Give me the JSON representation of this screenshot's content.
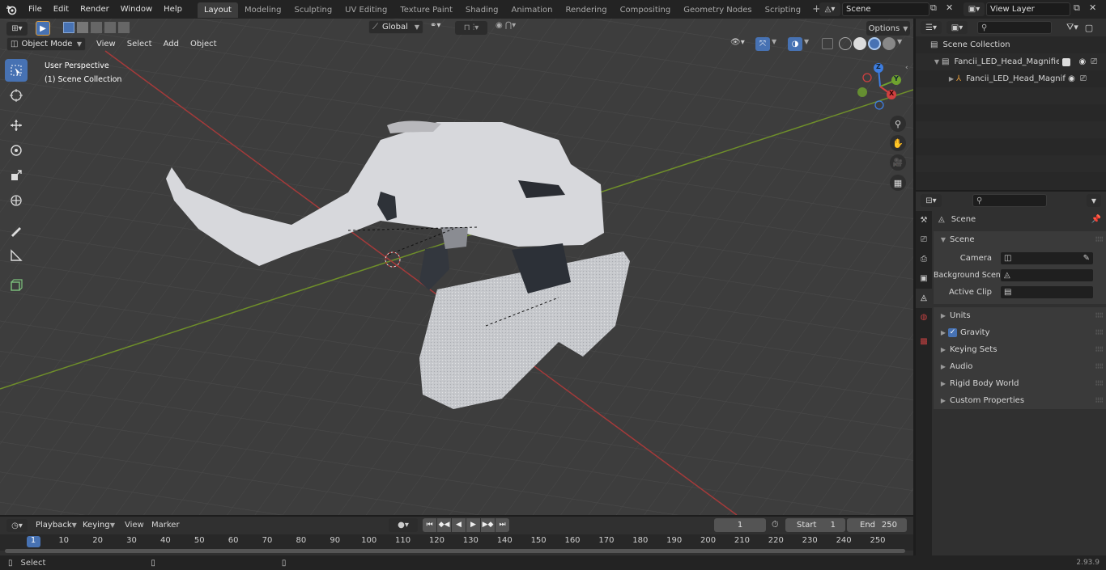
{
  "menu": {
    "items": [
      "File",
      "Edit",
      "Render",
      "Window",
      "Help"
    ]
  },
  "workspaces": {
    "tabs": [
      "Layout",
      "Modeling",
      "Sculpting",
      "UV Editing",
      "Texture Paint",
      "Shading",
      "Animation",
      "Rendering",
      "Compositing",
      "Geometry Nodes",
      "Scripting"
    ],
    "active": "Layout"
  },
  "scene_selector": {
    "value": "Scene"
  },
  "view_layer": {
    "value": "View Layer"
  },
  "viewport": {
    "mode": "Object Mode",
    "menus": [
      "View",
      "Select",
      "Add",
      "Object"
    ],
    "orientation": "Global",
    "options_label": "Options",
    "overlay_title": "User Perspective",
    "overlay_sub": "(1) Scene Collection",
    "gizmo_axes": {
      "x": "X",
      "y": "Y",
      "z": "Z"
    }
  },
  "outliner": {
    "title": "Scene Collection",
    "items": [
      {
        "label": "Fancii_LED_Head_Magnifier_V"
      },
      {
        "label": "Fancii_LED_Head_Magnif"
      }
    ]
  },
  "properties": {
    "context": "Scene",
    "section": "Scene",
    "fields": [
      {
        "label": "Camera"
      },
      {
        "label": "Background Scene"
      },
      {
        "label": "Active Clip"
      }
    ],
    "panels": [
      "Units",
      "Gravity",
      "Keying Sets",
      "Audio",
      "Rigid Body World",
      "Custom Properties"
    ]
  },
  "timeline": {
    "menus": [
      "Playback",
      "Keying",
      "View",
      "Marker"
    ],
    "current_frame": "1",
    "start_label": "Start",
    "start_value": "1",
    "end_label": "End",
    "end_value": "250",
    "ticks": [
      "1",
      "10",
      "20",
      "30",
      "40",
      "50",
      "60",
      "70",
      "80",
      "90",
      "100",
      "110",
      "120",
      "130",
      "140",
      "150",
      "160",
      "170",
      "180",
      "190",
      "200",
      "210",
      "220",
      "230",
      "240",
      "250"
    ]
  },
  "status": {
    "select_label": "Select",
    "version": "2.93.9"
  }
}
